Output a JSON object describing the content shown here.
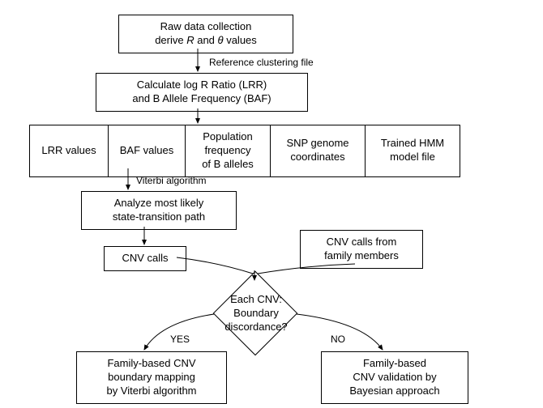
{
  "nodes": {
    "raw1": "Raw data collection",
    "raw2": "derive R and θ values",
    "calc1": "Calculate log R Ratio (LRR)",
    "calc2": "and B Allele Frequency (BAF)",
    "row_lrr": "LRR values",
    "row_baf": "BAF values",
    "row_pop1": "Population",
    "row_pop2": "frequency",
    "row_pop3": "of B alleles",
    "row_snp1": "SNP genome",
    "row_snp2": "coordinates",
    "row_hmm1": "Trained HMM",
    "row_hmm2": "model file",
    "analyze1": "Analyze most likely",
    "analyze2": "state-transition path",
    "cnv": "CNV calls",
    "family1": "CNV calls from",
    "family2": "family members",
    "diamond1": "Each CNV:",
    "diamond2": "Boundary",
    "diamond3": "discordance?",
    "left1": "Family-based CNV",
    "left2": "boundary mapping",
    "left3": "by Viterbi algorithm",
    "right1": "Family-based",
    "right2": "CNV validation by",
    "right3": "Bayesian approach"
  },
  "labels": {
    "ref": "Reference clustering file",
    "viterbi": "Viterbi algorithm",
    "yes": "YES",
    "no": "NO"
  }
}
